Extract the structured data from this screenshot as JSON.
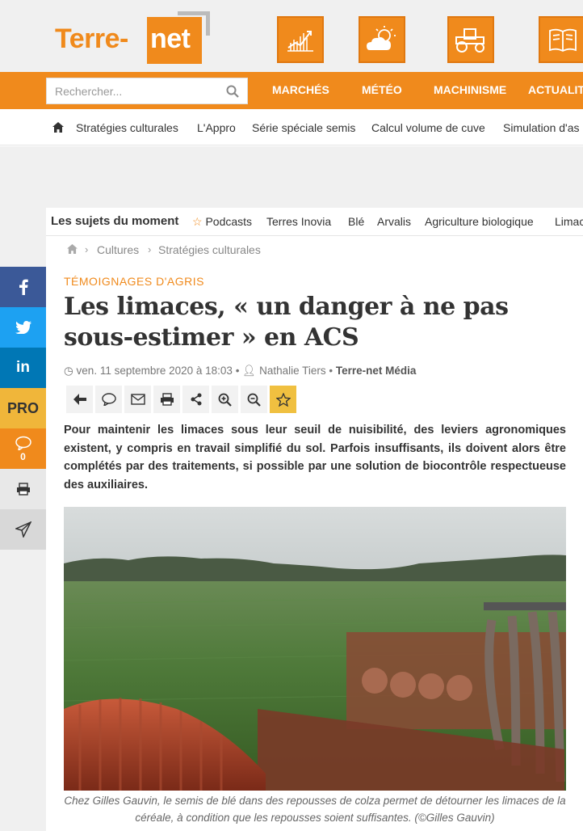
{
  "brand": {
    "name_part1": "Terre-",
    "name_part2": "net",
    "accent": "#f08a1c"
  },
  "header_tiles": [
    {
      "icon": "chart-growth-icon"
    },
    {
      "icon": "weather-sun-cloud-icon"
    },
    {
      "icon": "tractor-icon"
    },
    {
      "icon": "newspaper-icon"
    }
  ],
  "search": {
    "placeholder": "Rechercher..."
  },
  "main_nav": [
    "MARCHÉS",
    "MÉTÉO",
    "MACHINISME",
    "ACTUALITÉ"
  ],
  "sub_nav": [
    "Stratégies culturales",
    "L'Appro",
    "Série spéciale semis",
    "Calcul volume de cuve",
    "Simulation d'as"
  ],
  "trending": {
    "title": "Les sujets du moment",
    "items": [
      "Podcasts",
      "Terres Inovia",
      "Blé",
      "Arvalis",
      "Agriculture biologique",
      "Limac"
    ]
  },
  "breadcrumb": [
    "Cultures",
    "Stratégies culturales"
  ],
  "article": {
    "category": "TÉMOIGNAGES D'AGRIS",
    "title": "Les limaces, « un danger à ne pas sous-estimer » en ACS",
    "date": "ven. 11 septembre 2020 à 18:03",
    "author": "Nathalie Tiers",
    "source": "Terre-net Média",
    "lead": "Pour maintenir les limaces sous leur seuil de nuisibilité, des leviers agronomiques existent, y compris en travail simplifié du sol. Parfois insuffisants, ils doivent alors être complétés par des traitements, si possible par une solution de biocontrôle respectueuse des auxiliaires.",
    "caption": "Chez Gilles Gauvin, le semis de blé dans des repousses de colza permet de détourner les limaces de la céréale, à condition que les repousses soient suffisantes. (©Gilles Gauvin)"
  },
  "share_bar": {
    "pro_label": "PRO",
    "comment_count": "0",
    "facebook_color": "#3b5998",
    "twitter_color": "#1da1f2",
    "linkedin_color": "#0077b5",
    "pro_color": "#f0b63a"
  }
}
